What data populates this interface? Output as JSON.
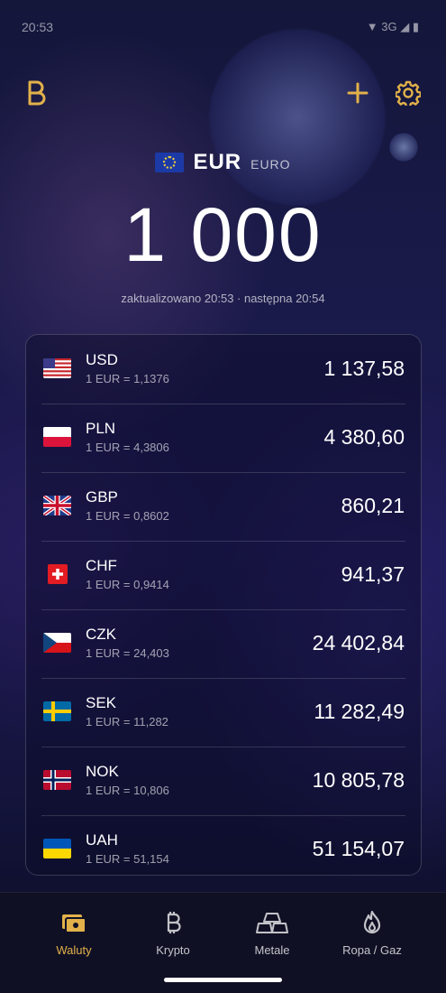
{
  "status_bar": {
    "time": "20:53",
    "network": "3G"
  },
  "header": {
    "logo_icon": "logo-b-icon",
    "add_icon": "plus-icon",
    "settings_icon": "gear-icon"
  },
  "base": {
    "code": "EUR",
    "name": "EURO",
    "flag": "eu-flag-icon"
  },
  "amount": "1 000",
  "update_text": "zaktualizowano 20:53 · następna 20:54",
  "rates": [
    {
      "code": "USD",
      "rate": "1 EUR = 1,1376",
      "value": "1 137,58",
      "flag": "us-flag-icon"
    },
    {
      "code": "PLN",
      "rate": "1 EUR = 4,3806",
      "value": "4 380,60",
      "flag": "pl-flag-icon"
    },
    {
      "code": "GBP",
      "rate": "1 EUR = 0,8602",
      "value": "860,21",
      "flag": "gb-flag-icon"
    },
    {
      "code": "CHF",
      "rate": "1 EUR = 0,9414",
      "value": "941,37",
      "flag": "ch-flag-icon"
    },
    {
      "code": "CZK",
      "rate": "1 EUR = 24,403",
      "value": "24 402,84",
      "flag": "cz-flag-icon"
    },
    {
      "code": "SEK",
      "rate": "1 EUR = 11,282",
      "value": "11 282,49",
      "flag": "se-flag-icon"
    },
    {
      "code": "NOK",
      "rate": "1 EUR = 10,806",
      "value": "10 805,78",
      "flag": "no-flag-icon"
    },
    {
      "code": "UAH",
      "rate": "1 EUR = 51,154",
      "value": "51 154,07",
      "flag": "ua-flag-icon"
    }
  ],
  "nav": [
    {
      "label": "Waluty",
      "icon": "cash-icon",
      "active": true
    },
    {
      "label": "Krypto",
      "icon": "bitcoin-icon",
      "active": false
    },
    {
      "label": "Metale",
      "icon": "gold-bars-icon",
      "active": false
    },
    {
      "label": "Ropa / Gaz",
      "icon": "flame-icon",
      "active": false
    }
  ],
  "colors": {
    "accent": "#e2b14a",
    "background": "#16174a"
  }
}
